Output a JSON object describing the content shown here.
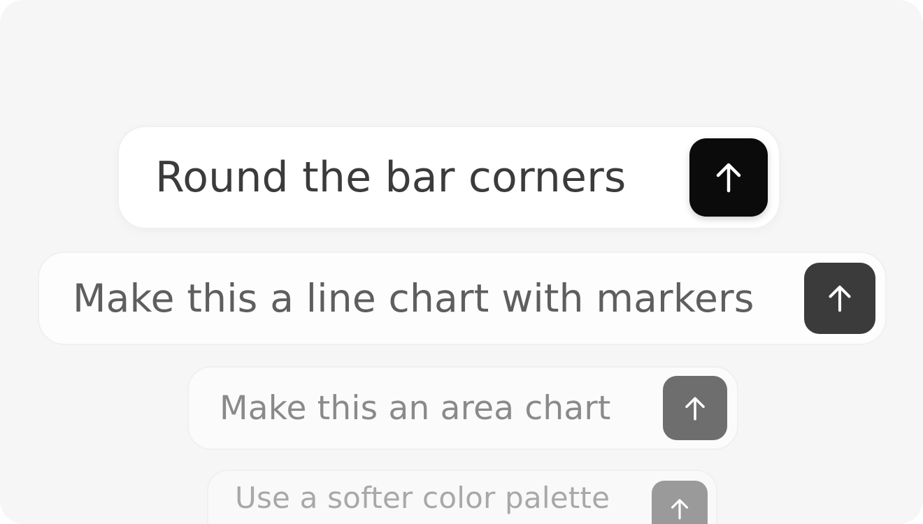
{
  "suggestions": [
    {
      "text": "Round the bar corners",
      "send_icon": "arrow-up-icon",
      "button_color": "#0b0b0b"
    },
    {
      "text": "Make this a line chart with markers",
      "send_icon": "arrow-up-icon",
      "button_color": "#3b3b3b"
    },
    {
      "text": "Make this an area chart",
      "send_icon": "arrow-up-icon",
      "button_color": "#6e6e6e"
    },
    {
      "text": "Use a softer color palette",
      "send_icon": "arrow-up-icon",
      "button_color": "#9a9a9a"
    }
  ],
  "colors": {
    "background": "#f6f6f6",
    "pill": "#ffffff"
  }
}
